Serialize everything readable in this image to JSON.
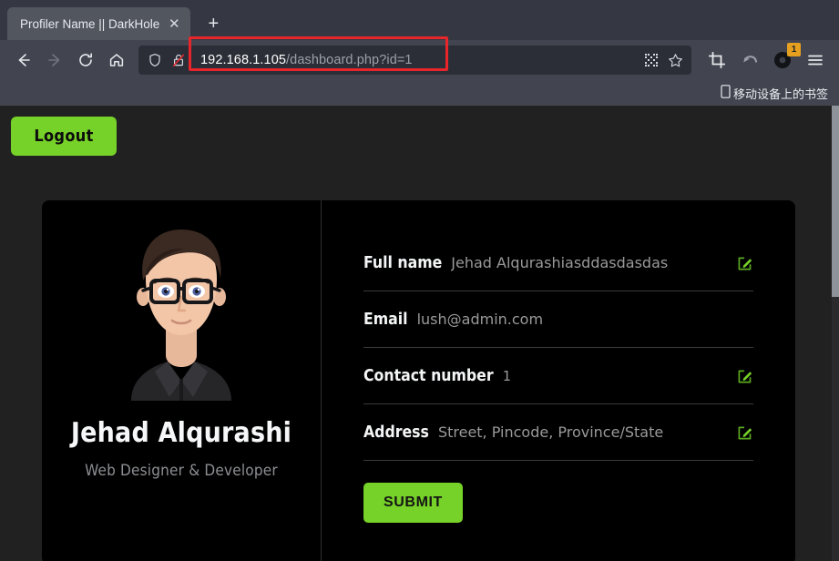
{
  "browser": {
    "tab": {
      "title": "Profiler Name || DarkHole",
      "close_label": "✕",
      "newtab_label": "+"
    },
    "nav": {
      "back": "back-arrow",
      "forward": "forward-arrow",
      "reload": "reload",
      "home": "home"
    },
    "url": {
      "host": "192.168.1.105",
      "path": "/dashboard.php?id=1",
      "full": "192.168.1.105/dashboard.php?id=1",
      "highlight_color": "#e8252b",
      "shield_icon": "shield-icon",
      "insecure_icon": "broken-lock-icon"
    },
    "toolbar": {
      "qr_icon": "qr-code-icon",
      "bookmark_icon": "star-icon",
      "crop_icon": "crop-icon",
      "undo_icon": "undo-arrow-icon",
      "extension_icon": "extension-icon",
      "extension_badge": "1",
      "badge_color": "#e6a020",
      "menu_icon": "hamburger-menu-icon"
    },
    "bookmarks": [
      {
        "label": "移动设备上的书签",
        "icon": "mobile-device-icon"
      }
    ]
  },
  "page": {
    "logout_label": "Logout",
    "accent_green": "#76d128",
    "card_bg": "#000000",
    "page_bg": "#212121",
    "profile": {
      "name": "Jehad Alqurashi",
      "role": "Web Designer & Developer",
      "avatar_alt": "avatar-illustration-man-with-glasses"
    },
    "form": {
      "fields": [
        {
          "label": "Full name",
          "value": "Jehad Alqurashiasddasdasdas",
          "is_placeholder": false,
          "editable": true
        },
        {
          "label": "Email",
          "value": "lush@admin.com",
          "is_placeholder": false,
          "editable": false
        },
        {
          "label": "Contact number",
          "value": "1",
          "is_placeholder": false,
          "editable": true
        },
        {
          "label": "Address",
          "value": "Street, Pincode, Province/State",
          "is_placeholder": true,
          "editable": true
        }
      ],
      "submit_label": "SUBMIT"
    }
  }
}
